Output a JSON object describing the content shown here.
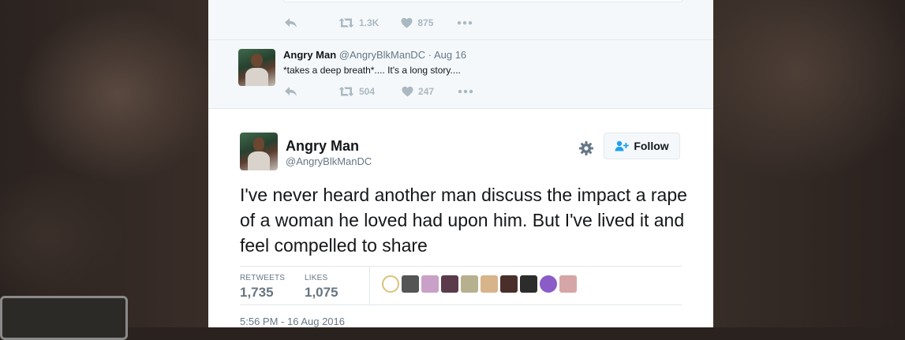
{
  "top_tweet": {
    "reply_icon": "reply-icon",
    "retweets": "1.3K",
    "likes": "875",
    "more_icon": "more-icon"
  },
  "reply_tweet": {
    "author_name": "Angry Man",
    "author_handle": "@AngryBlkManDC",
    "separator": "·",
    "date": "Aug 16",
    "text": "*takes a deep breath*.... It's a long story....",
    "retweets": "504",
    "likes": "247"
  },
  "main_tweet": {
    "author_name": "Angry Man",
    "author_handle": "@AngryBlkManDC",
    "follow_label": "Follow",
    "text": "I've never heard another man discuss the impact a rape of a woman he loved had upon him. But I've lived it and feel compelled to share",
    "stats": {
      "retweets_label": "RETWEETS",
      "retweets_value": "1,735",
      "likes_label": "LIKES",
      "likes_value": "1,075"
    },
    "liker_colors": [
      "#e8d9a8",
      "#555555",
      "#c9a0c8",
      "#5b3b4a",
      "#b6b08e",
      "#d8b48a",
      "#4a2e2a",
      "#2c2c2c",
      "#8b5cc7",
      "#d6a6a6"
    ],
    "timestamp": "5:56 PM - 16 Aug 2016"
  },
  "colors": {
    "action_gray": "#aab8c2",
    "text_primary": "#14171a",
    "text_muted": "#657786",
    "border": "#e1e8ed",
    "follow_blue": "#1da1f2"
  }
}
